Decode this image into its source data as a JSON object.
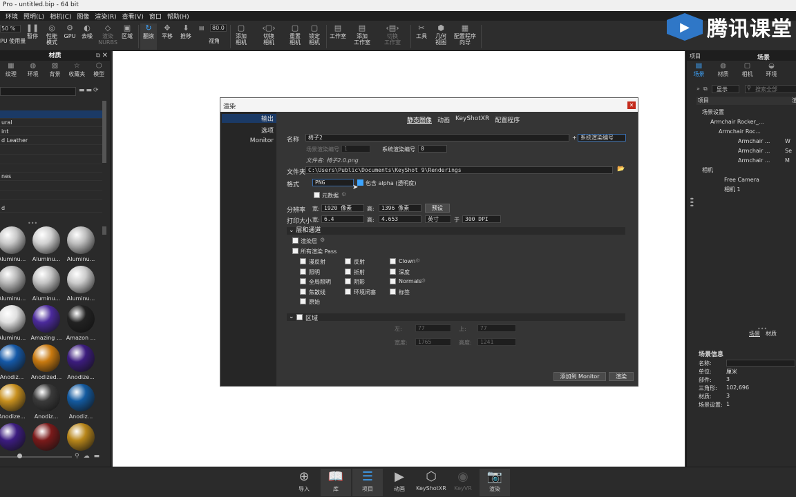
{
  "window": {
    "title": "Pro - untitled.bip - 64 bit"
  },
  "menu": [
    "环境",
    "照明(L)",
    "相机(C)",
    "图像",
    "渲染(R)",
    "查看(V)",
    "窗口",
    "帮助(H)"
  ],
  "toolbar": {
    "zoom_value": "50 %",
    "cpu_label": "PU 使用量",
    "items": [
      {
        "label": "暂停",
        "icon": "pause-icon"
      },
      {
        "label": "性能\n模式",
        "icon": "performance-icon"
      },
      {
        "label": "GPU",
        "icon": "gpu-icon"
      },
      {
        "label": "去噪",
        "icon": "denoise-icon"
      },
      {
        "label": "渲染\nNURBS",
        "icon": "nurbs-icon"
      },
      {
        "label": "区域",
        "icon": "region-icon"
      },
      {
        "label": "翻滚",
        "icon": "tumble-icon"
      },
      {
        "label": "平移",
        "icon": "pan-icon"
      },
      {
        "label": "推移",
        "icon": "dolly-icon"
      },
      {
        "label": "视角",
        "icon": "fov-icon"
      },
      {
        "label": "添加\n相机",
        "icon": "add-camera-icon"
      },
      {
        "label": "切换\n相机",
        "icon": "switch-camera-icon"
      },
      {
        "label": "重置\n相机",
        "icon": "reset-camera-icon"
      },
      {
        "label": "锁定\n相机",
        "icon": "lock-camera-icon"
      },
      {
        "label": "工作室",
        "icon": "studio-icon"
      },
      {
        "label": "添加\n工作室",
        "icon": "add-studio-icon"
      },
      {
        "label": "切换\n工作室",
        "icon": "switch-studio-icon"
      },
      {
        "label": "工具",
        "icon": "tools-icon"
      },
      {
        "label": "几何\n视图",
        "icon": "geometry-view-icon"
      },
      {
        "label": "配置程序\n向导",
        "icon": "configurator-icon"
      }
    ],
    "fov_value": "80.0"
  },
  "logo": {
    "text": "腾讯课堂"
  },
  "left_panel": {
    "title": "材质",
    "tabs": [
      "纹理",
      "环境",
      "背景",
      "收藏夹",
      "模型"
    ],
    "tree": [
      "",
      "ural",
      "int",
      "d Leather",
      "",
      "",
      "",
      "nes",
      "",
      "",
      "d"
    ],
    "materials": [
      {
        "label": "Aluminu...",
        "color": "#c8c8c8"
      },
      {
        "label": "Aluminu...",
        "color": "#d0d0d0"
      },
      {
        "label": "Aluminu...",
        "color": "#bdbdbd"
      },
      {
        "label": "Aluminu...",
        "color": "#b8b8b8"
      },
      {
        "label": "Aluminu...",
        "color": "#c4c4c4"
      },
      {
        "label": "Aluminu...",
        "color": "#cccccc"
      },
      {
        "label": "Aluminu...",
        "color": "#e0e0e0"
      },
      {
        "label": "Amazing ...",
        "color": "#4b2a9c"
      },
      {
        "label": "Amazon ...",
        "color": "#222222"
      },
      {
        "label": "Anodiz...",
        "color": "#1559a8"
      },
      {
        "label": "Anodized...",
        "color": "#c97a10"
      },
      {
        "label": "Anodize...",
        "color": "#3c1c7e"
      },
      {
        "label": "Anodize...",
        "color": "#c8901e"
      },
      {
        "label": "Anodiz...",
        "color": "#3a3a3a"
      },
      {
        "label": "Anodiz...",
        "color": "#135aa0"
      },
      {
        "label": "",
        "color": "#3c1c80"
      },
      {
        "label": "",
        "color": "#7a1a1a"
      },
      {
        "label": "",
        "color": "#b8861a"
      }
    ]
  },
  "render_dialog": {
    "title": "渲染",
    "sidebar": [
      "输出",
      "选项",
      "Monitor"
    ],
    "tabs": [
      "静态图像",
      "动画",
      "KeyShotXR",
      "配置程序"
    ],
    "name_label": "名称",
    "name_value": "椅子2",
    "name_suffix": "系统渲染编号",
    "scene_number_label": "场景渲染编号",
    "scene_number_value": "1",
    "sys_number_label": "系统渲染编号",
    "sys_number_value": "0",
    "filename_hint": "文件名: 椅子2.0.png",
    "folder_label": "文件夹",
    "folder_value": "C:\\Users\\Public\\Documents\\KeyShot 9\\Renderings",
    "format_label": "格式",
    "format_value": "PNG",
    "alpha_label": "包含 alpha (透明度)",
    "metadata_label": "元数据",
    "resolution_label": "分辨率",
    "width_label": "宽:",
    "width_value": "1920 像素",
    "height_label": "高:",
    "height_value": "1396 像素",
    "preset_label": "预设",
    "print_label": "打印大小",
    "print_w_label": "宽:",
    "print_w_value": "6.4",
    "print_h_label": "高:",
    "print_h_value": "4.653",
    "print_unit": "英寸",
    "print_at": "于",
    "dpi_value": "300 DPI",
    "layers_section": "层和通道",
    "render_layer_label": "渲染层",
    "all_passes_label": "所有渲染 Pass",
    "passes": [
      [
        "漫反射",
        "反射",
        "Clown"
      ],
      [
        "照明",
        "折射",
        "深度"
      ],
      [
        "全局照明",
        "阴影",
        "Normals"
      ],
      [
        "焦散线",
        "环境闭塞",
        "标签"
      ],
      [
        "原始",
        "",
        ""
      ]
    ],
    "region_section": "区域",
    "left_label": "左:",
    "left_value": "77",
    "top_label": "上:",
    "top_value": "77",
    "rw_label": "宽度:",
    "rw_value": "1765",
    "rh_label": "高度:",
    "rh_value": "1241",
    "add_monitor_btn": "添加到 Monitor",
    "render_btn": "渲染"
  },
  "right_panel": {
    "project_label": "项目",
    "title": "场景",
    "tabs": [
      "场景",
      "材质",
      "相机",
      "环境"
    ],
    "show_label": "显示",
    "search_placeholder": "搜索全部",
    "col_header": "项目",
    "col_header2": "渲",
    "tree": [
      {
        "text": "场景设置",
        "indent": 8
      },
      {
        "text": "Armchair Rocker_...",
        "indent": 20
      },
      {
        "text": "Armchair Roc...",
        "indent": 32
      },
      {
        "text": "Armchair ...",
        "indent": 60,
        "suffix": "W"
      },
      {
        "text": "Armchair ...",
        "indent": 60,
        "suffix": "Se"
      },
      {
        "text": "Armchair ...",
        "indent": 60,
        "suffix": "M"
      },
      {
        "text": "相机",
        "indent": 8
      },
      {
        "text": "Free Camera",
        "indent": 40
      },
      {
        "text": "相机 1",
        "indent": 40
      }
    ],
    "bottom_tabs": [
      "场景",
      "材质"
    ],
    "info_title": "场景信息",
    "info": [
      {
        "k": "名称:",
        "v": ""
      },
      {
        "k": "单位:",
        "v": "厘米"
      },
      {
        "k": "部件:",
        "v": "3"
      },
      {
        "k": "三角形:",
        "v": "102,696"
      },
      {
        "k": "材质:",
        "v": "3"
      },
      {
        "k": "场景设置:",
        "v": "1"
      }
    ]
  },
  "bottom_bar": [
    {
      "label": "导入",
      "icon": "import-icon"
    },
    {
      "label": "库",
      "icon": "library-icon"
    },
    {
      "label": "项目",
      "icon": "project-icon"
    },
    {
      "label": "动画",
      "icon": "animation-icon"
    },
    {
      "label": "KeyShotXR",
      "icon": "keyshotxr-icon"
    },
    {
      "label": "KeyVR",
      "icon": "keyvr-icon"
    },
    {
      "label": "渲染",
      "icon": "render-icon"
    }
  ]
}
